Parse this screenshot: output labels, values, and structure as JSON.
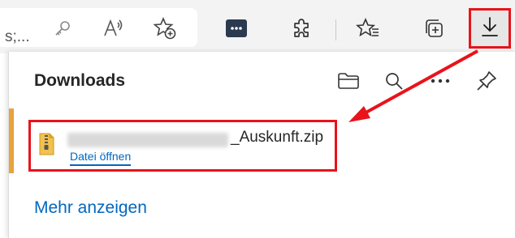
{
  "toolbar": {
    "address_tail": "s;...",
    "icons": [
      "key-icon",
      "read-aloud-icon",
      "add-favorite-icon",
      "extension-badge-icon",
      "extensions-icon",
      "favorites-icon",
      "collections-icon",
      "downloads-icon"
    ]
  },
  "downloads": {
    "title": "Downloads",
    "items": [
      {
        "file_name": "_Auskunft.zip",
        "action": "Datei öffnen"
      }
    ],
    "more": "Mehr anzeigen"
  },
  "colors": {
    "highlight": "#e8131b",
    "link": "#0067c0",
    "accent": "#e8a33d"
  }
}
